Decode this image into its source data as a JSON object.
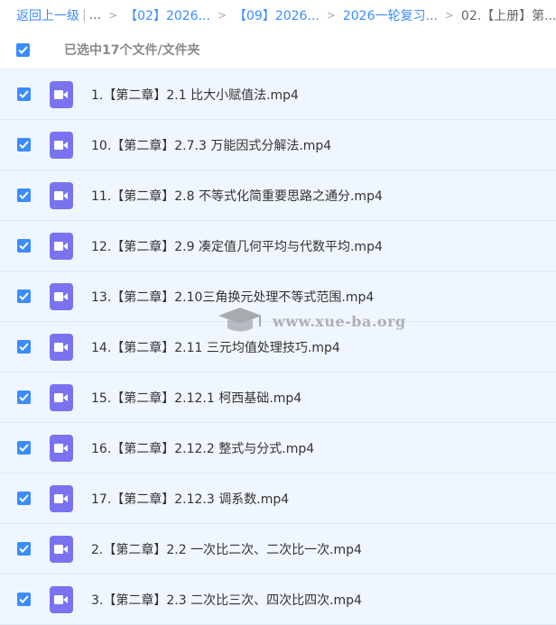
{
  "breadcrumb": {
    "back": "返回上一级",
    "dots": "...",
    "items": [
      "【02】2026...",
      "【09】2026...",
      "2026一轮复习..."
    ],
    "current": "02.【上册】第..."
  },
  "selection": {
    "text": "已选中17个文件/文件夹"
  },
  "files": [
    {
      "name": "1.【第二章】2.1 比大小赋值法.mp4"
    },
    {
      "name": "10.【第二章】2.7.3 万能因式分解法.mp4"
    },
    {
      "name": "11.【第二章】2.8 不等式化简重要思路之通分.mp4"
    },
    {
      "name": "12.【第二章】2.9 凑定值几何平均与代数平均.mp4"
    },
    {
      "name": "13.【第二章】2.10三角换元处理不等式范围.mp4"
    },
    {
      "name": "14.【第二章】2.11 三元均值处理技巧.mp4"
    },
    {
      "name": "15.【第二章】2.12.1 柯西基础.mp4"
    },
    {
      "name": "16.【第二章】2.12.2 整式与分式.mp4"
    },
    {
      "name": "17.【第二章】2.12.3 调系数.mp4"
    },
    {
      "name": "2.【第二章】2.2 一次比二次、二次比一次.mp4"
    },
    {
      "name": "3.【第二章】2.3 二次比三次、四次比四次.mp4"
    }
  ],
  "watermark": {
    "text": "www.xue-ba.org"
  },
  "colors": {
    "accent": "#3b8cff",
    "video_icon": "#7a73f0",
    "row_bg": "#f0f6ff"
  },
  "icons": {
    "checkbox": "checkbox-checked-icon",
    "file": "video-file-icon"
  }
}
